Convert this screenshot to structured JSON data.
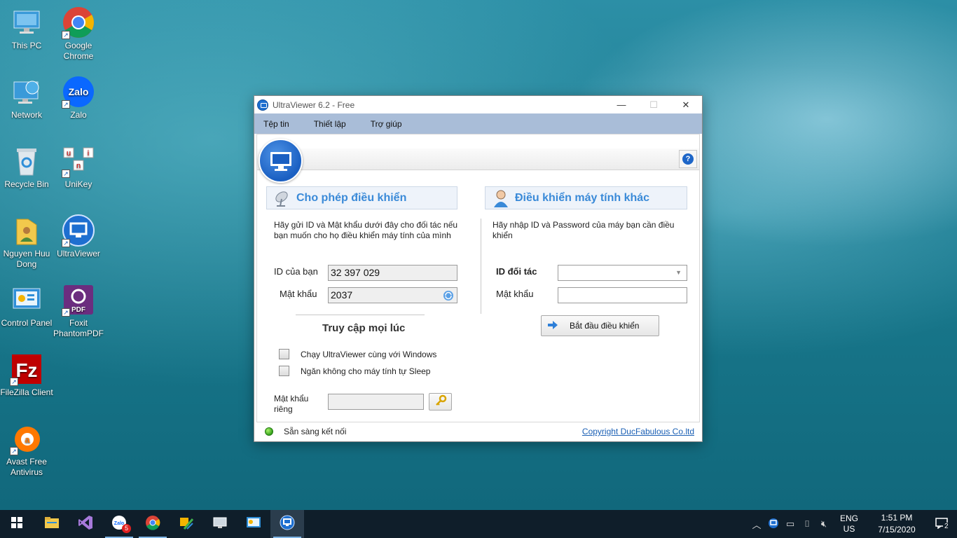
{
  "desktop": {
    "icons": [
      {
        "label": "This PC"
      },
      {
        "label": "Google Chrome"
      },
      {
        "label": "Network"
      },
      {
        "label": "Zalo"
      },
      {
        "label": "Recycle Bin"
      },
      {
        "label": "UniKey"
      },
      {
        "label": "Nguyen Huu Dong"
      },
      {
        "label": "UltraViewer"
      },
      {
        "label": "Control Panel"
      },
      {
        "label": "Foxit PhantomPDF"
      },
      {
        "label": "FileZilla Client"
      },
      {
        "label": "Avast Free Antivirus"
      }
    ]
  },
  "window": {
    "title": "UltraViewer 6.2 - Free",
    "controls": {
      "minimize": "—",
      "maximize": "☐",
      "close": "✕"
    },
    "menu": [
      "Tệp tin",
      "Thiết lập",
      "Trợ giúp"
    ],
    "help_icon": "?",
    "left": {
      "header": "Cho phép điều khiển",
      "description": "Hãy gửi ID và Mật khẩu dưới đây cho đối tác nếu bạn muốn cho họ điều khiển máy tính của mình",
      "id_label": "ID của bạn",
      "id_value": "32 397 029",
      "password_label": "Mật khẩu",
      "password_value": "2037",
      "unattended_title": "Truy cập mọi lúc",
      "checkbox_startup": "Chạy UltraViewer cùng với Windows",
      "checkbox_sleep": "Ngăn không cho máy tính tự Sleep",
      "private_password_label": "Mật khẩu riêng",
      "private_password_value": ""
    },
    "right": {
      "header": "Điều khiển máy tính khác",
      "description": "Hãy nhập ID và Password của máy bạn cần điều khiển",
      "partner_id_label": "ID đối tác",
      "partner_id_value": "",
      "password_label": "Mật khẩu",
      "password_value": "",
      "start_button": "Bắt đầu điều khiển"
    },
    "status": {
      "text": "Sẵn sàng kết nối",
      "copyright": "Copyright DucFabulous Co.ltd",
      "status_color": "#3cb521"
    }
  },
  "taskbar": {
    "zalo_badge": "5",
    "language": "ENG",
    "region": "US",
    "time": "1:51 PM",
    "date": "7/15/2020",
    "notifications": "2"
  }
}
